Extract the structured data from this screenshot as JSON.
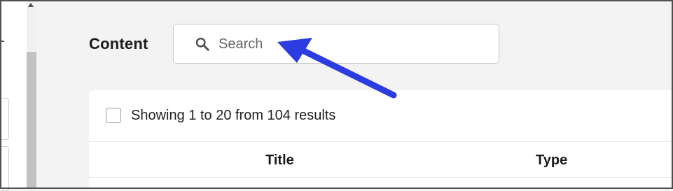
{
  "page": {
    "title": "Content"
  },
  "search": {
    "placeholder": "Search"
  },
  "results": {
    "summary": "Showing 1 to 20 from 104 results",
    "columns": [
      "Title",
      "Type"
    ]
  },
  "annotation": {
    "color": "#2b3ce0",
    "points_to": "search-input"
  },
  "icons": {
    "search": "search-icon",
    "select_all": "checkbox"
  }
}
